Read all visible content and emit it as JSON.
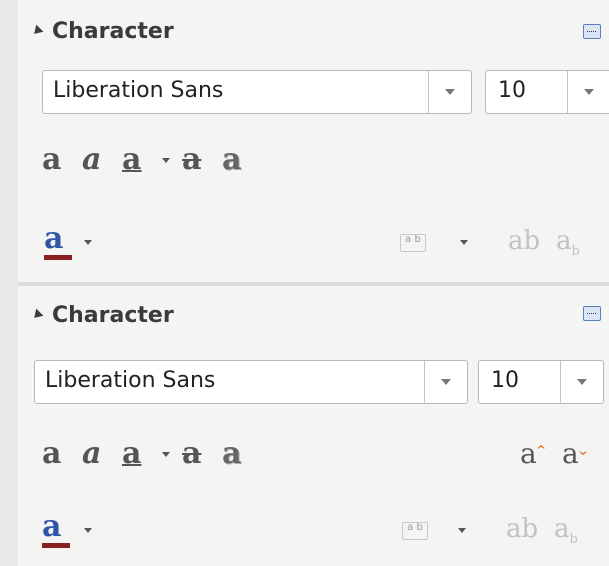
{
  "panels": [
    {
      "title": "Character",
      "font_name": "Liberation Sans",
      "font_size": "10",
      "format_glyphs": {
        "bold": "a",
        "italic": "a",
        "underline": "a",
        "strike": "a",
        "shadow": "a"
      },
      "font_color_glyph": "a",
      "spacing_label": "a b",
      "super_glyph": "ab",
      "sub_glyph": "a",
      "sub_mark": "b"
    },
    {
      "title": "Character",
      "font_name": "Liberation Sans",
      "font_size": "10",
      "format_glyphs": {
        "bold": "a",
        "italic": "a",
        "underline": "a",
        "strike": "a",
        "shadow": "a"
      },
      "grow_glyph": "a",
      "shrink_glyph": "a",
      "font_color_glyph": "a",
      "spacing_label": "a b",
      "super_glyph": "ab",
      "sub_glyph": "a",
      "sub_mark": "b"
    }
  ],
  "colors": {
    "font_color_bar": "#8b1e1e",
    "font_color_letter": "#2f56a8",
    "grow_caret": "#e06b1a"
  },
  "icons": [
    "collapse-triangle-icon",
    "more-options-icon",
    "dropdown-arrow-icon",
    "bold-icon",
    "italic-icon",
    "underline-icon",
    "strikethrough-icon",
    "shadow-icon",
    "font-color-icon",
    "character-spacing-icon",
    "superscript-icon",
    "subscript-icon",
    "grow-font-icon",
    "shrink-font-icon"
  ]
}
